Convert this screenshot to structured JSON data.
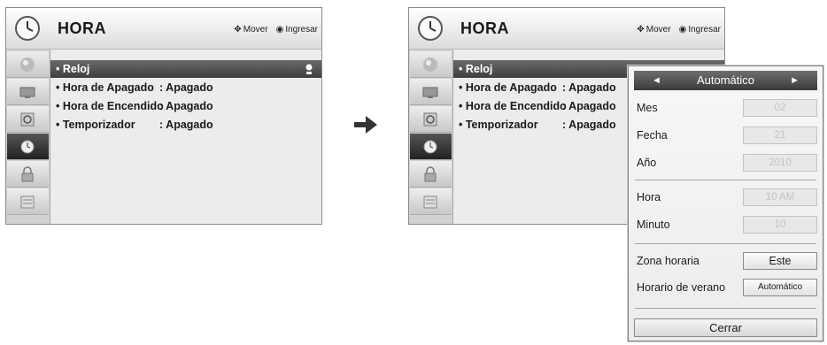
{
  "menu": {
    "title": "HORA",
    "hint_move": "Mover",
    "hint_enter": "Ingresar",
    "items": [
      {
        "label": "• Reloj",
        "value": ""
      },
      {
        "label": "• Hora de Apagado",
        "value": ": Apagado"
      },
      {
        "label": "• Hora de Encendido",
        "value": ": Apagado"
      },
      {
        "label": "• Temporizador",
        "value": ": Apagado"
      }
    ],
    "sidebar_icons": [
      "picture-icon",
      "tv-icon",
      "speaker-icon",
      "clock-icon",
      "lock-icon",
      "options-icon"
    ]
  },
  "popup": {
    "header": "Automático",
    "fields": [
      {
        "label": "Mes",
        "value": "02"
      },
      {
        "label": "Fecha",
        "value": "21"
      },
      {
        "label": "Año",
        "value": "2010"
      },
      {
        "label": "Hora",
        "value": "10 AM"
      },
      {
        "label": "Minuto",
        "value": "10"
      },
      {
        "label": "Zona horaria",
        "value": "Este"
      },
      {
        "label": "Horario de verano",
        "value": "Automático"
      }
    ],
    "close": "Cerrar"
  }
}
